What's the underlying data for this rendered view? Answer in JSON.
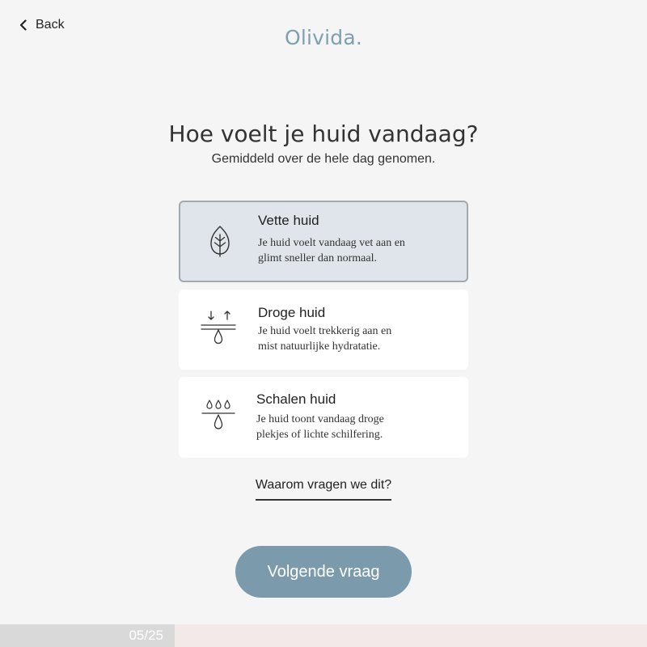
{
  "nav": {
    "back_label": "Back",
    "back_icon": "chevron-left-icon"
  },
  "brand": {
    "name": "Olivida",
    "dot": ".",
    "color": "#7d9fb0"
  },
  "question": {
    "title": "Hoe voelt je huid vandaag?",
    "subtitle": "Gemiddeld over de hele dag genomen."
  },
  "options": [
    {
      "title": "Vette huid",
      "desc_line1": "Je huid voelt vandaag vet aan en",
      "desc_line2": "glimt sneller dan normaal.",
      "icon": "leaf-icon",
      "selected": true
    },
    {
      "title": "Droge huid",
      "desc_line1": "Je huid voelt trekkerig aan en",
      "desc_line2": "mist natuurlijke hydratatie.",
      "icon": "moisture-loss-icon",
      "selected": false
    },
    {
      "title": "Schalen huid",
      "desc_line1": "Je huid toont vandaag droge",
      "desc_line2": "plekjes of lichte schilfering.",
      "icon": "droplets-icon",
      "selected": false
    }
  ],
  "why_link": "Waarom vragen we dit?",
  "next_button": "Volgende vraag",
  "progress": {
    "label": "05/25",
    "current": 5,
    "total": 25,
    "fill_color": "#d9d9d9",
    "track_color": "#f3e9e9"
  },
  "colors": {
    "background": "#f5f5f5",
    "selected_card": "#dfe5ea",
    "selected_border": "#a3a8ac",
    "primary_button": "#7b9bad"
  }
}
